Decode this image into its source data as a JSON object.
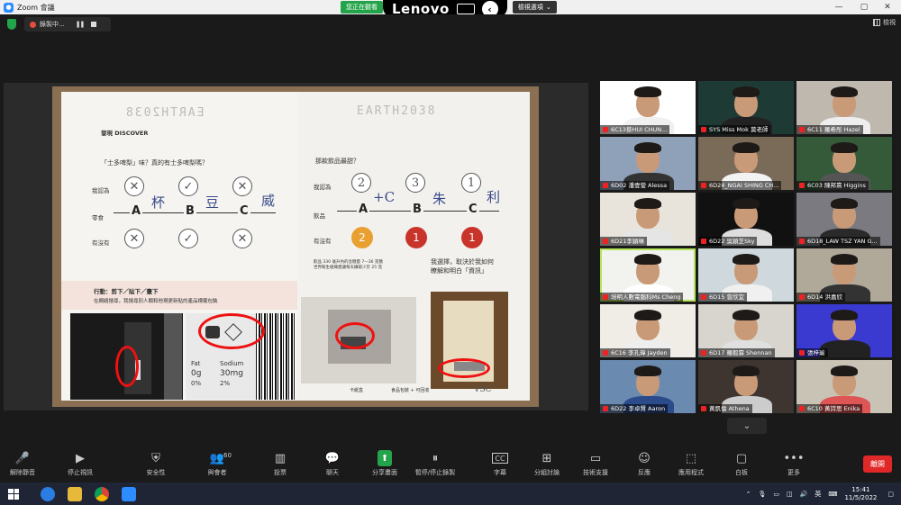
{
  "titlebar": {
    "title": "Zoom 會議",
    "min": "—",
    "max": "▢",
    "close": "✕"
  },
  "sharebar": {
    "status": "您正在觀看",
    "brand": "Lenovo",
    "options": "檢視選項",
    "options_caret": "⌄",
    "back": "‹"
  },
  "recording": {
    "label": "錄製中...",
    "pause": "❚❚"
  },
  "view": {
    "label": "檢視"
  },
  "booklet": {
    "left_title": "EARTH2038",
    "right_title": "EARTH2038",
    "left_section": "發現 DISCOVER",
    "left_question": "「士多啤梨」味？真的有士多啤梨嗎？",
    "row_labels": [
      "我認為",
      "零食",
      "有沒有"
    ],
    "right_question": "那款飲品最甜？",
    "right_rows": [
      "我認為",
      "飲品",
      "有沒有"
    ],
    "options": [
      "A",
      "B",
      "C"
    ],
    "left_marks_top": [
      "✕",
      "✓",
      "✕"
    ],
    "left_marks_bottom": [
      "✕",
      "✓",
      "✕"
    ],
    "left_hand": [
      "杯",
      "豆",
      "威"
    ],
    "right_ranks": [
      "2",
      "3",
      "1"
    ],
    "right_hand": [
      "+C",
      "朱",
      "利"
    ],
    "right_discs": [
      "2",
      "1",
      "1"
    ],
    "right_note": "我選擇，取決於我如何\n瞭解和明白「資訊」",
    "footnote": "飲品 330 毫升內的含糖量 7—36 克糖\n世界衛生組織建議每天攝取少於 25 克",
    "hands_title": "行動：剪下／貼下／畫下",
    "hands_text": "在網絡搜尋，我搜尋別人類和他現更新貼的產品標籤包裝",
    "label_sodium": "Sodium",
    "label_fat": "Fat",
    "label_val1": "0g",
    "label_val2": "30mg",
    "label_pct": "0%",
    "label_pct2": "2%",
    "photo_caption": "卡紙盒",
    "photo_caption2": "食品包裝 + 可回收",
    "signature": "VSC"
  },
  "gallery": [
    {
      "name": "6C13蔡HUI CHUN..."
    },
    {
      "name": "SYS Miss Mok 莫老師"
    },
    {
      "name": "6C11 羅希彤 Hazel"
    },
    {
      "name": "6D02 潘壹瑩 Alessa"
    },
    {
      "name": "6D24_NGAI SHING CH..."
    },
    {
      "name": "6C03 陳邦熹 Higgins"
    },
    {
      "name": "6D21李穎琳"
    },
    {
      "name": "6D22 吳穎芝Sky"
    },
    {
      "name": "6D18_LAW TSZ YAN G..."
    },
    {
      "name": "培明人數電腦科Ms Cheng"
    },
    {
      "name": "6D15 曾欣宜"
    },
    {
      "name": "6D14 洪嘉欣"
    },
    {
      "name": "6C16 李孔瑋 Jayden"
    },
    {
      "name": "6D17 羅毅霖 Shennan"
    },
    {
      "name": "張梓瑜"
    },
    {
      "name": "6D22 李卓賢 Aaron"
    },
    {
      "name": "黃凱倫 Athena"
    },
    {
      "name": "6C10 黃詩思 Enika"
    }
  ],
  "gallery_next": "⌄",
  "toolbar": {
    "items": [
      {
        "label": "解除靜音",
        "icon": "🎤"
      },
      {
        "label": "停止視訊",
        "icon": "▶"
      },
      {
        "label": "安全性",
        "icon": "⛨"
      },
      {
        "label": "與會者",
        "icon": "👥",
        "count": "60"
      },
      {
        "label": "投票",
        "icon": "▥"
      },
      {
        "label": "聊天",
        "icon": "💬"
      },
      {
        "label": "分享畫面",
        "icon": "⬆"
      },
      {
        "label": "暫停/停止錄製",
        "icon": "⏸"
      },
      {
        "label": "字幕",
        "icon": "CC"
      },
      {
        "label": "分組討論",
        "icon": "⊞"
      },
      {
        "label": "技術支援",
        "icon": "▭"
      },
      {
        "label": "反應",
        "icon": "☺"
      },
      {
        "label": "應用程式",
        "icon": "⬚"
      },
      {
        "label": "白板",
        "icon": "▢"
      },
      {
        "label": "更多",
        "icon": "•••"
      }
    ],
    "leave": "離開"
  },
  "taskbar": {
    "ime": "英",
    "time": "15:41",
    "date": "11/5/2022",
    "tray_up": "⌃"
  },
  "colors": {
    "zoom_blue": "#2d8cff",
    "share_green": "#23a34a",
    "leave_red": "#e02828",
    "circle_red": "#e11111"
  }
}
